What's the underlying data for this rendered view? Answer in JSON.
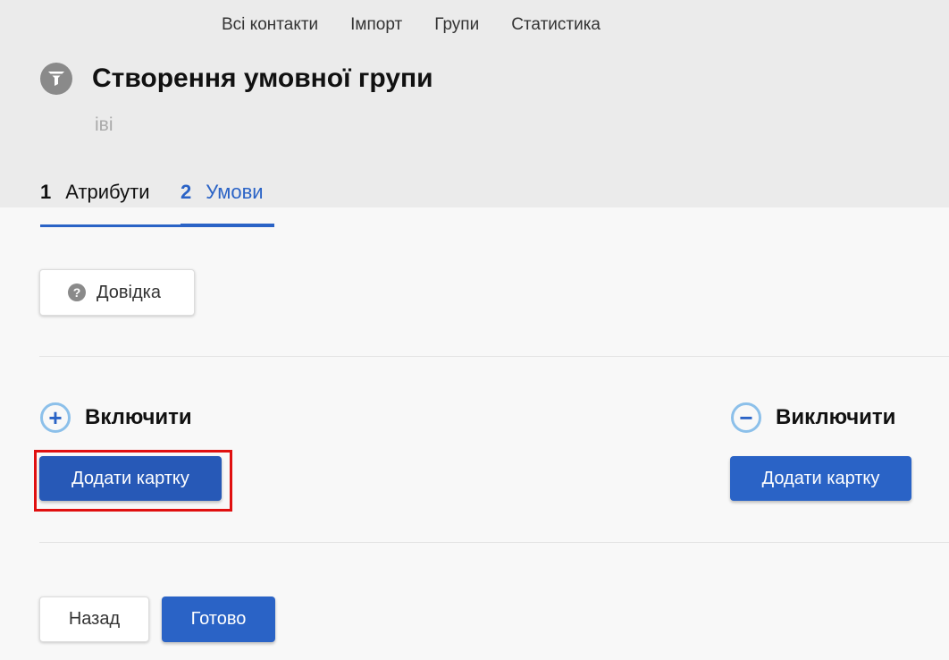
{
  "nav": {
    "items": [
      "Всі контакти",
      "Імпорт",
      "Групи",
      "Статистика"
    ]
  },
  "page": {
    "title": "Створення умовної групи",
    "subtitle": "іві",
    "icon": "funnel-icon"
  },
  "steps": [
    {
      "num": "1",
      "label": "Атрибути"
    },
    {
      "num": "2",
      "label": "Умови"
    }
  ],
  "help_button": {
    "label": "Довідка",
    "icon": "question-icon"
  },
  "include": {
    "title": "Включити",
    "icon": "plus-icon",
    "add_label": "Додати картку"
  },
  "exclude": {
    "title": "Виключити",
    "icon": "minus-icon",
    "add_label": "Додати картку"
  },
  "footer": {
    "back_label": "Назад",
    "done_label": "Готово"
  },
  "colors": {
    "accent": "#2a63c6",
    "highlight": "#e01010",
    "header_bg": "#ebebeb"
  }
}
